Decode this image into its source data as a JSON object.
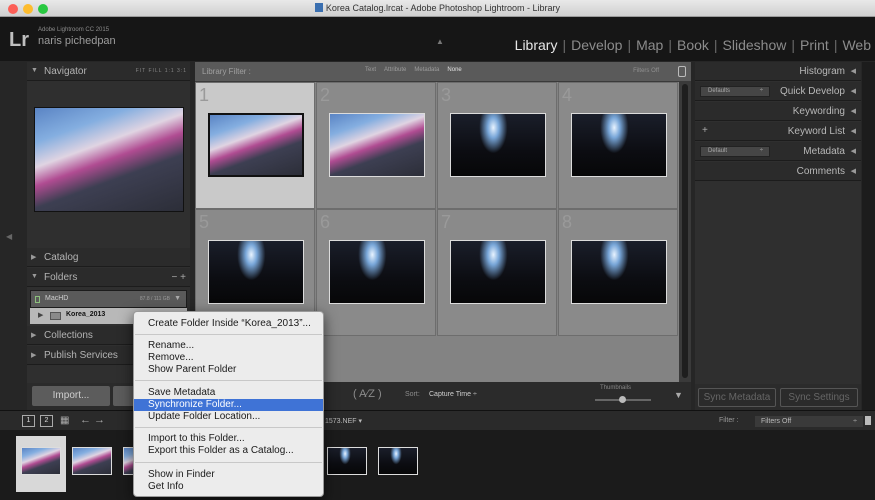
{
  "window": {
    "title": "Korea Catalog.lrcat - Adobe Photoshop Lightroom - Library"
  },
  "identity": {
    "logo": "Lr",
    "product": "Adobe Lightroom CC 2015",
    "user": "naris pichedpan"
  },
  "modules": {
    "items": [
      "Library",
      "Develop",
      "Map",
      "Book",
      "Slideshow",
      "Print",
      "Web"
    ],
    "active": "Library"
  },
  "left_panel": {
    "navigator": {
      "label": "Navigator",
      "options": "FIT FILL 1:1 3:1"
    },
    "catalog": {
      "label": "Catalog"
    },
    "folders": {
      "label": "Folders",
      "controls": "− +"
    },
    "volume": {
      "name": "MacHD",
      "size": "87.8 / 111 GB"
    },
    "folder": {
      "name": "Korea_2013"
    },
    "collections": {
      "label": "Collections"
    },
    "publish_services": {
      "label": "Publish Services"
    },
    "import_label": "Import..."
  },
  "filter_bar": {
    "title": "Library Filter :",
    "options": [
      "Text",
      "Attribute",
      "Metadata",
      "None"
    ],
    "active": "None",
    "filters_off": "Filters Off"
  },
  "grid": {
    "cells": [
      {
        "index": "1",
        "kind": "street",
        "selected": true
      },
      {
        "index": "2",
        "kind": "street",
        "selected": false
      },
      {
        "index": "3",
        "kind": "dark",
        "selected": false
      },
      {
        "index": "4",
        "kind": "dark",
        "selected": false
      },
      {
        "index": "5",
        "kind": "dark",
        "selected": false
      },
      {
        "index": "6",
        "kind": "dark",
        "selected": false
      },
      {
        "index": "7",
        "kind": "dark",
        "selected": false
      },
      {
        "index": "8",
        "kind": "dark",
        "selected": false
      }
    ]
  },
  "toolbar": {
    "sort_label": "Sort:",
    "sort_value": "Capture Time ÷",
    "thumbnails_label": "Thumbnails"
  },
  "right_panel": {
    "histogram": "Histogram",
    "quick_develop": "Quick Develop",
    "quick_develop_preset": "Defaults",
    "keywording": "Keywording",
    "keyword_list": "Keyword List",
    "metadata": "Metadata",
    "metadata_preset": "Default",
    "comments": "Comments",
    "sync_metadata": "Sync Metadata",
    "sync_settings": "Sync Settings"
  },
  "filmstrip_bar": {
    "monitor1": "1",
    "monitor2": "2",
    "path": "1573.NEF ▾",
    "filter_label": "Filter :",
    "filter_value": "Filters Off"
  },
  "filmstrip": {
    "thumbs": [
      {
        "kind": "street",
        "selected": true
      },
      {
        "kind": "street",
        "selected": false
      },
      {
        "kind": "street",
        "selected": false
      },
      {
        "kind": "dark",
        "selected": false
      },
      {
        "kind": "dark",
        "selected": false
      },
      {
        "kind": "dark",
        "selected": false
      },
      {
        "kind": "dark",
        "selected": false
      },
      {
        "kind": "dark",
        "selected": false
      }
    ]
  },
  "context_menu": {
    "items": [
      "Create Folder Inside “Korea_2013”...",
      "Rename...",
      "Remove...",
      "Show Parent Folder",
      "Save Metadata",
      "Synchronize Folder...",
      "Update Folder Location...",
      "Import to this Folder...",
      "Export this Folder as a Catalog...",
      "Show in Finder",
      "Get Info"
    ],
    "highlighted": "Synchronize Folder..."
  },
  "colors": {
    "menu_highlight": "#3f73d6",
    "panel_bg": "#2f2f2f",
    "grid_bg": "#838383"
  }
}
